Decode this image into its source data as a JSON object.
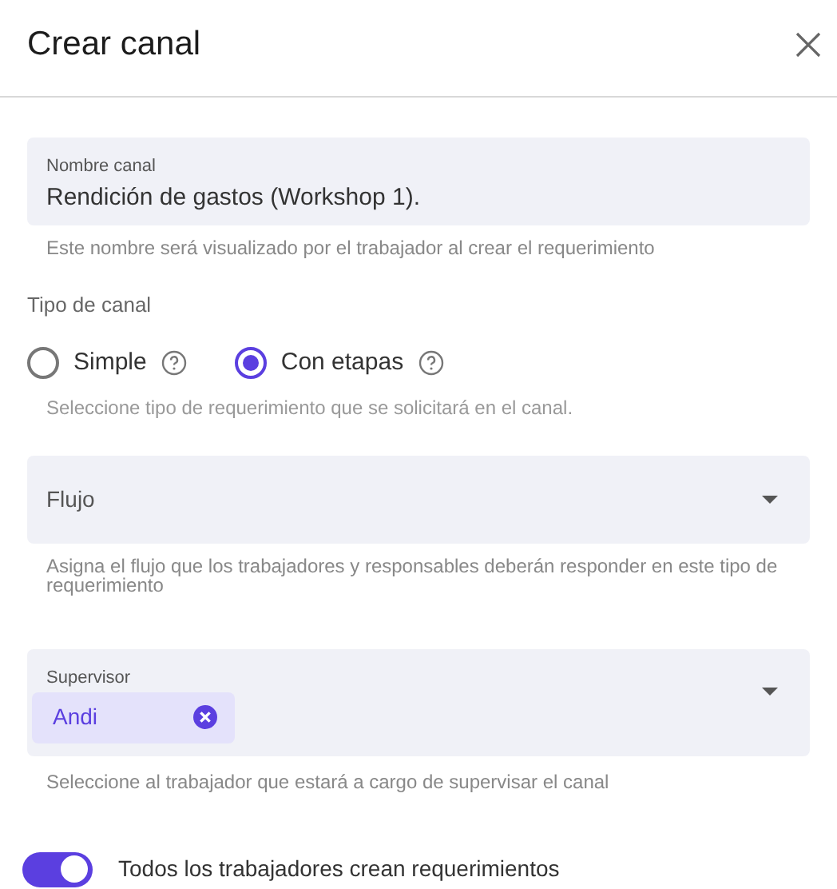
{
  "dialog": {
    "title": "Crear canal"
  },
  "name_field": {
    "label": "Nombre canal",
    "value": "Rendición de gastos (Workshop 1).",
    "helper": "Este nombre será visualizado por el trabajador al crear el requerimiento"
  },
  "channel_type": {
    "label": "Tipo de canal",
    "options": [
      {
        "label": "Simple",
        "selected": false
      },
      {
        "label": "Con etapas",
        "selected": true
      }
    ],
    "helper": "Seleccione tipo de requerimiento que se solicitará en el canal."
  },
  "flow_select": {
    "placeholder": "Flujo",
    "helper": "Asigna el flujo que los trabajadores y responsables deberán responder en este tipo de requerimiento"
  },
  "supervisor_select": {
    "label": "Supervisor",
    "chips": [
      "Andi"
    ],
    "helper": "Seleccione al trabajador que estará a cargo de supervisar el canal"
  },
  "toggle": {
    "label": "Todos los trabajadores crean requerimientos",
    "on": true
  }
}
